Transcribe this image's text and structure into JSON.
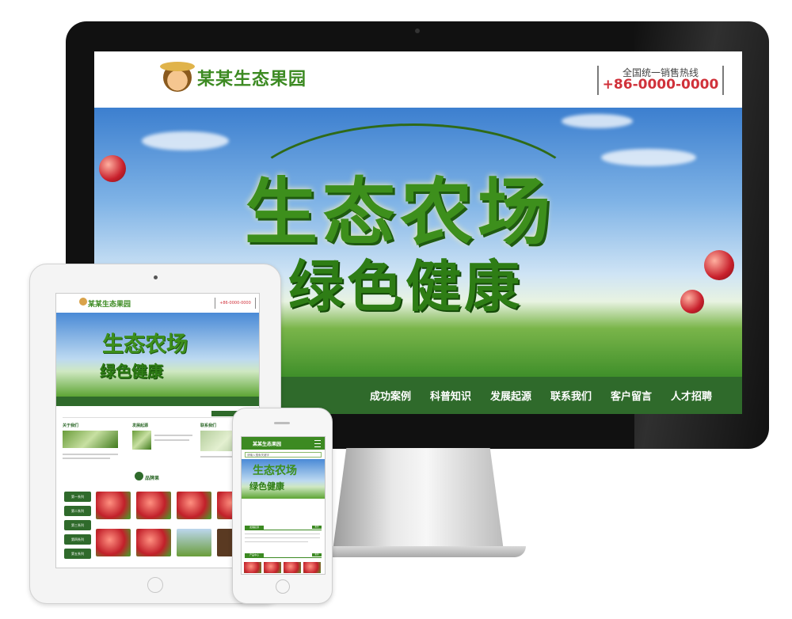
{
  "desktop": {
    "logo_text": "某某生态果园",
    "hotline_label": "全国统一销售热线",
    "hotline_number": "+86-0000-0000",
    "banner_title_line1": "生态农场",
    "banner_title_line2": "绿色健康",
    "nav_items": [
      "成功案例",
      "科普知识",
      "发展起源",
      "联系我们",
      "客户留言",
      "人才招聘"
    ]
  },
  "tablet": {
    "logo_text": "某某生态果园",
    "hotline_number": "+86-0000-0000",
    "banner_title_line1": "生态农场",
    "banner_title_line2": "绿色健康",
    "sections": [
      "关于我们",
      "发展起源",
      "联系我们"
    ],
    "products_title": "品牌果",
    "side_buttons": [
      "第一系列",
      "第二系列",
      "第三系列",
      "第四系列",
      "第五系列"
    ]
  },
  "phone": {
    "logo_text": "某某生态果园",
    "search_placeholder": "请输入搜索关键字",
    "banner_title_line1": "生态农场",
    "banner_title_line2": "绿色健康",
    "bars": [
      "发展起源",
      "产品中心"
    ],
    "more_label": "更多"
  },
  "colors": {
    "brand_green": "#3c8a22",
    "nav_green": "#2f6a2b",
    "hotline_red": "#d0313a"
  }
}
